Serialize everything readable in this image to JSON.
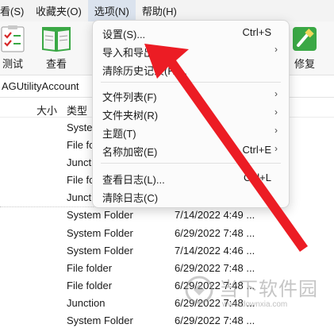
{
  "menubar": {
    "items": [
      "看(S)",
      "收藏夹(O)",
      "选项(N)",
      "帮助(H)"
    ]
  },
  "toolbar": {
    "buttons": [
      {
        "label": "测试",
        "icon": "test-checklist-icon"
      },
      {
        "label": "查看",
        "icon": "open-book-icon"
      },
      {
        "label": "修复",
        "icon": "repair-brush-icon"
      }
    ]
  },
  "path": {
    "text": "AGUtilityAccount"
  },
  "columns": {
    "size": "大小",
    "type": "类型"
  },
  "rows": [
    {
      "type": "Syste",
      "date": ""
    },
    {
      "type": "File fo",
      "date": ""
    },
    {
      "type": "Junctio",
      "date": ""
    },
    {
      "type": "File fo",
      "date": ""
    },
    {
      "type": "Juncti",
      "date": ""
    },
    {
      "type": "System Folder",
      "date": "7/14/2022 4:49 ..."
    },
    {
      "type": "System Folder",
      "date": "6/29/2022 7:48 ..."
    },
    {
      "type": "System Folder",
      "date": "7/14/2022 4:46 ..."
    },
    {
      "type": "File folder",
      "date": "6/29/2022 7:48 ..."
    },
    {
      "type": "File folder",
      "date": "6/29/2022 7:48 ..."
    },
    {
      "type": "Junction",
      "date": "6/29/2022 7:48 ..."
    },
    {
      "type": "System Folder",
      "date": "6/29/2022 7:48 ..."
    }
  ],
  "options_menu": {
    "items": [
      {
        "label": "设置(S)...",
        "shortcut": "Ctrl+S",
        "submenu": false
      },
      {
        "label": "导入和导出(I)",
        "shortcut": "",
        "submenu": true
      },
      {
        "label": "清除历史记录(H)...",
        "shortcut": "",
        "submenu": false
      },
      {
        "label": "文件列表(F)",
        "shortcut": "",
        "submenu": true
      },
      {
        "label": "文件夹树(R)",
        "shortcut": "",
        "submenu": true
      },
      {
        "label": "主题(T)",
        "shortcut": "",
        "submenu": true
      },
      {
        "label": "名称加密(E)",
        "shortcut": "Ctrl+E",
        "submenu": true
      },
      {
        "label": "查看日志(L)...",
        "shortcut": "Ctrl+L",
        "submenu": false
      },
      {
        "label": "清除日志(C)",
        "shortcut": "",
        "submenu": false
      }
    ]
  },
  "watermark": {
    "site": "当下软件园",
    "url": "www.downxia.com"
  },
  "colors": {
    "annotation_arrow": "#ec1c24",
    "toolbar_green": "#3aa845",
    "menu_highlight": "#dbe3ee"
  }
}
